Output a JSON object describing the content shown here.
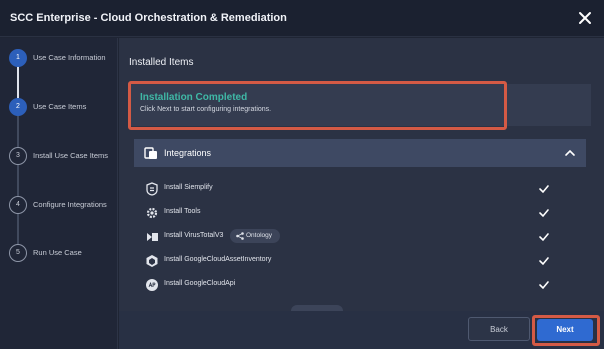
{
  "window": {
    "title": "SCC Enterprise - Cloud Orchestration & Remediation"
  },
  "steps": [
    {
      "num": "1",
      "label": "Use Case Information",
      "state": "done"
    },
    {
      "num": "2",
      "label": "Use Case Items",
      "state": "active"
    },
    {
      "num": "3",
      "label": "Install Use Case Items",
      "state": "todo"
    },
    {
      "num": "4",
      "label": "Configure Integrations",
      "state": "todo"
    },
    {
      "num": "5",
      "label": "Run Use Case",
      "state": "todo"
    }
  ],
  "main": {
    "section_title": "Installed Items",
    "banner": {
      "heading": "Installation Completed",
      "message": "Click Next to start configuring integrations."
    },
    "integrations": {
      "label": "Integrations",
      "items": [
        {
          "label": "Install Siemplify",
          "icon": "siemplify-icon",
          "status": "installed"
        },
        {
          "label": "Install Tools",
          "icon": "gear-icon",
          "status": "installed"
        },
        {
          "label": "Install VirusTotalV3",
          "icon": "virustotal-icon",
          "status": "installed",
          "tag": "Ontology"
        },
        {
          "label": "Install GoogleCloudAssetInventory",
          "icon": "hexagon-icon",
          "status": "installed"
        },
        {
          "label": "Install GoogleCloudApi",
          "icon": "api-icon",
          "status": "installed"
        }
      ]
    }
  },
  "footer": {
    "back_label": "Back",
    "next_label": "Next"
  },
  "colors": {
    "accent": "#2f6ad1",
    "success_text": "#3fb8a6",
    "highlight": "#d45a45",
    "background": "#2b3244"
  }
}
